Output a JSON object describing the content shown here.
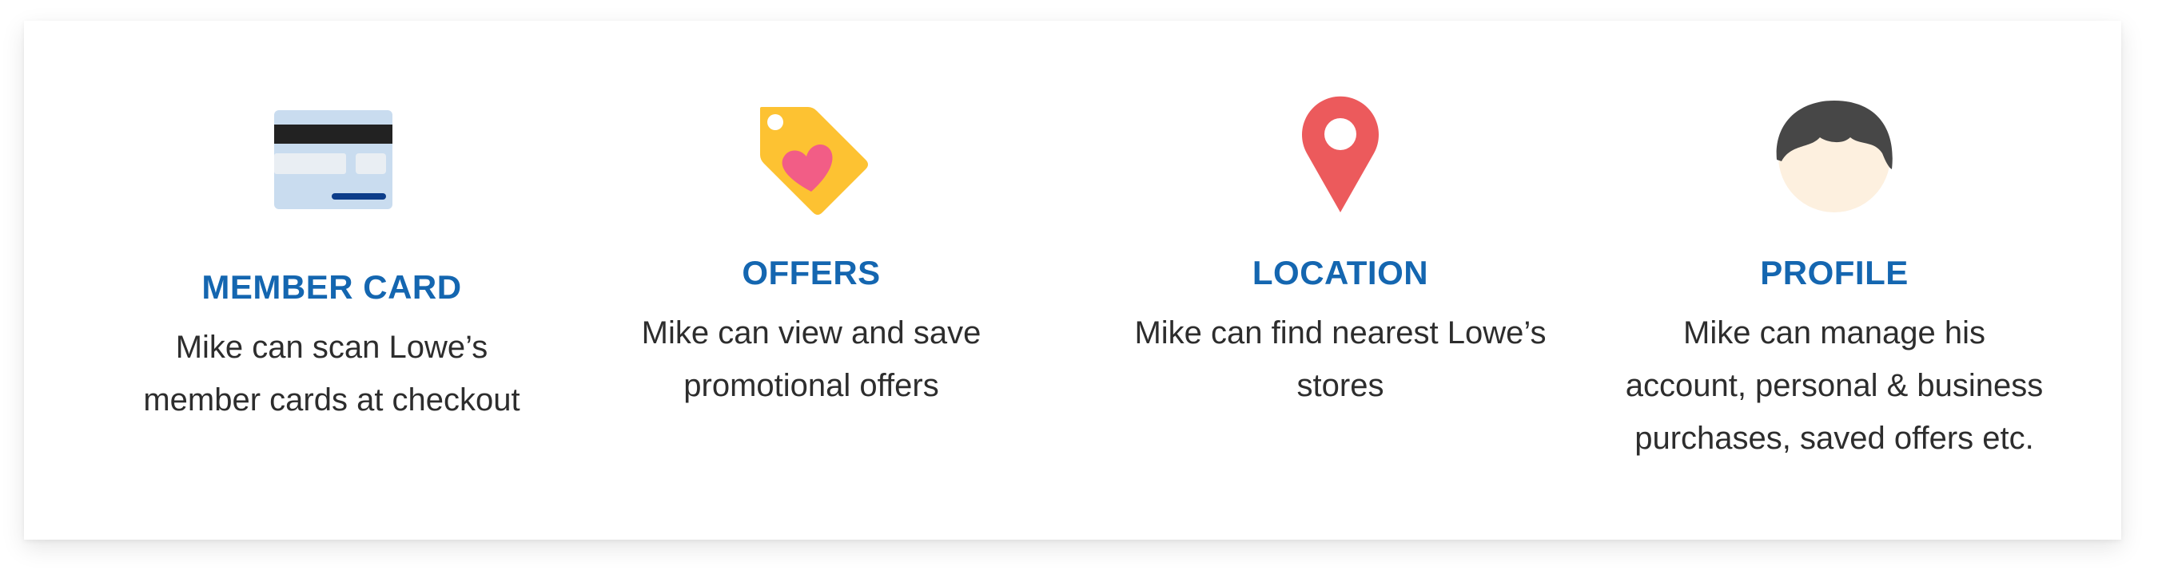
{
  "features": [
    {
      "icon": "member-card-icon",
      "title": "MEMBER CARD",
      "desc_line1": "Mike can scan Lowe’s",
      "desc_line2": "member cards at checkout",
      "desc_line3": ""
    },
    {
      "icon": "offer-tag-icon",
      "title": "OFFERS",
      "desc_line1": "Mike can view and save",
      "desc_line2": "promotional offers",
      "desc_line3": ""
    },
    {
      "icon": "location-pin-icon",
      "title": "LOCATION",
      "desc_line1": "Mike can find nearest Lowe’s",
      "desc_line2": "stores",
      "desc_line3": ""
    },
    {
      "icon": "profile-avatar-icon",
      "title": "PROFILE",
      "desc_line1": "Mike can manage his",
      "desc_line2": "account, personal & business",
      "desc_line3": "purchases, saved offers etc."
    }
  ],
  "colors": {
    "title": "#1466b0",
    "text": "#2d2d2d",
    "card_bg": "#c9dcef",
    "card_stripe": "#222222",
    "card_accent": "#0c3d8a",
    "tag": "#fdc232",
    "heart": "#f25d86",
    "pin": "#ec5a5c",
    "hair": "#474747",
    "skin": "#fdf0df"
  }
}
